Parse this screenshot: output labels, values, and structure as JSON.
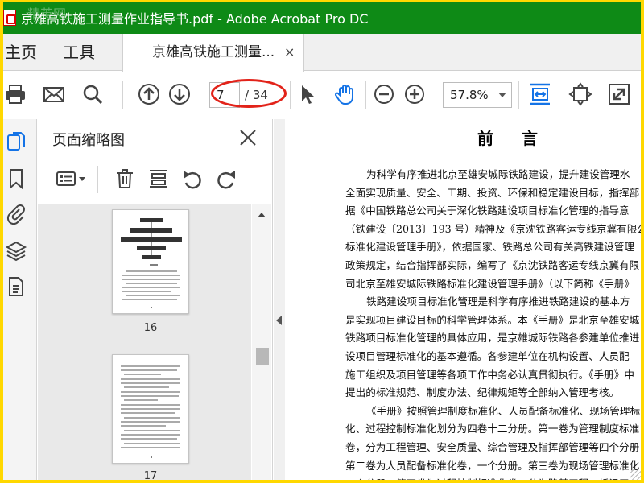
{
  "window": {
    "title": "京雄高铁施工测量作业指导书.pdf - Adobe Acrobat Pro DC",
    "watermark": "精英网"
  },
  "tabs": {
    "home": "主页",
    "tools": "工具",
    "document": "京雄高铁施工测量...",
    "close_glyph": "×"
  },
  "toolbar": {
    "current_page": "7",
    "total_pages": "/ 34",
    "zoom": "57.8%"
  },
  "thumbnails": {
    "title": "页面缩略图",
    "pages": [
      {
        "label": "16"
      },
      {
        "label": "17"
      }
    ]
  },
  "document": {
    "heading": "前 言",
    "lines": [
      "为科学有序推进北京至雄安城际铁路建设，提升建设管理水",
      "全面实现质量、安全、工期、投资、环保和稳定建设目标，指挥部",
      "据《中国铁路总公司关于深化铁路建设项目标准化管理的指导意",
      "（铁建设〔2013〕193 号）精神及《京沈铁路客运专线京冀有限公",
      "标准化建设管理手册》，依据国家、铁路总公司有关高铁建设管理",
      "政策规定，结合指挥部实际，编写了《京沈铁路客运专线京冀有限",
      "司北京至雄安城际铁路标准化建设管理手册》（以下简称《手册》",
      "铁路建设项目标准化管理是科学有序推进铁路建设的基本方",
      "是实现项目建设目标的科学管理体系。本《手册》是北京至雄安城",
      "铁路项目标准化管理的具体应用，是京雄城际铁路各参建单位推进",
      "设项目管理标准化的基本遵循。各参建单位在机构设置、人员配",
      "施工组织及项目管理等各项工作中务必认真贯彻执行。《手册》中",
      "提出的标准规范、制度办法、纪律规矩等全部纳入管理考核。",
      "《手册》按照管理制度标准化、人员配备标准化、现场管理标",
      "化、过程控制标准化划分为四卷十二分册。第一卷为管理制度标准",
      "卷，分为工程管理、安全质量、综合管理及指挥部管理等四个分册",
      "第二卷为人员配备标准化卷，一个分册。第三卷为现场管理标准化",
      "一个分册。第四卷为过程控制标准化卷，分为路基工程、桥涵工"
    ]
  }
}
